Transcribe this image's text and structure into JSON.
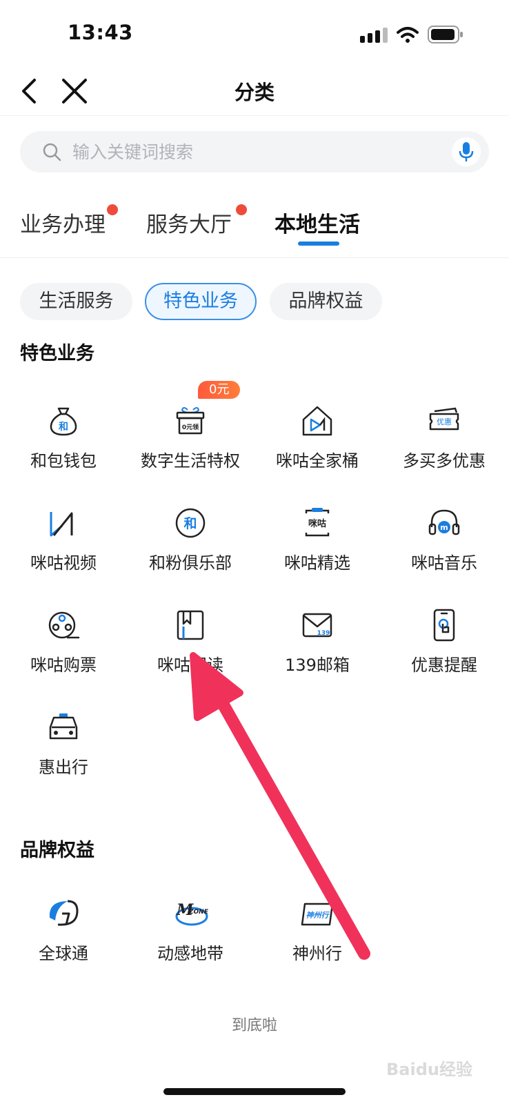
{
  "status_bar": {
    "time": "13:43"
  },
  "nav": {
    "title": "分类"
  },
  "search": {
    "placeholder": "输入关键词搜索"
  },
  "main_tabs": [
    {
      "label": "业务办理",
      "has_dot": true
    },
    {
      "label": "服务大厅",
      "has_dot": true
    },
    {
      "label": "本地生活",
      "active": true
    }
  ],
  "chips": [
    {
      "label": "生活服务"
    },
    {
      "label": "特色业务",
      "active": true
    },
    {
      "label": "品牌权益"
    }
  ],
  "sections": {
    "featured": {
      "title": "特色业务",
      "items": [
        {
          "label": "和包钱包",
          "icon": "wallet-bag-icon"
        },
        {
          "label": "数字生活特权",
          "icon": "gift-box-icon",
          "badge": "0元",
          "icon_text": "0元领"
        },
        {
          "label": "咪咕全家桶",
          "icon": "home-play-icon"
        },
        {
          "label": "多买多优惠",
          "icon": "coupon-icon",
          "icon_text": "优惠"
        },
        {
          "label": "咪咕视频",
          "icon": "video-play-icon"
        },
        {
          "label": "和粉俱乐部",
          "icon": "he-circle-icon",
          "icon_text": "和"
        },
        {
          "label": "咪咕精选",
          "icon": "migu-select-icon",
          "icon_text": "咪咕"
        },
        {
          "label": "咪咕音乐",
          "icon": "headphones-icon"
        },
        {
          "label": "咪咕购票",
          "icon": "film-reel-icon"
        },
        {
          "label": "咪咕阅读",
          "icon": "book-icon"
        },
        {
          "label": "139邮箱",
          "icon": "mail-icon",
          "icon_text": "139"
        },
        {
          "label": "优惠提醒",
          "icon": "phone-touch-icon"
        },
        {
          "label": "惠出行",
          "icon": "taxi-icon"
        }
      ]
    },
    "brand": {
      "title": "品牌权益",
      "items": [
        {
          "label": "全球通",
          "icon": "gotone-logo-icon"
        },
        {
          "label": "动感地带",
          "icon": "mzone-logo-icon"
        },
        {
          "label": "神州行",
          "icon": "easyown-logo-icon",
          "icon_text": "神州行"
        }
      ]
    }
  },
  "footer": {
    "end_text": "到底啦"
  },
  "watermark": {
    "text": "Baidu经验"
  },
  "colors": {
    "accent": "#1a7ee0",
    "dot": "#ef4b3c",
    "badge": "#ff5a3c",
    "arrow": "#f0325a"
  }
}
